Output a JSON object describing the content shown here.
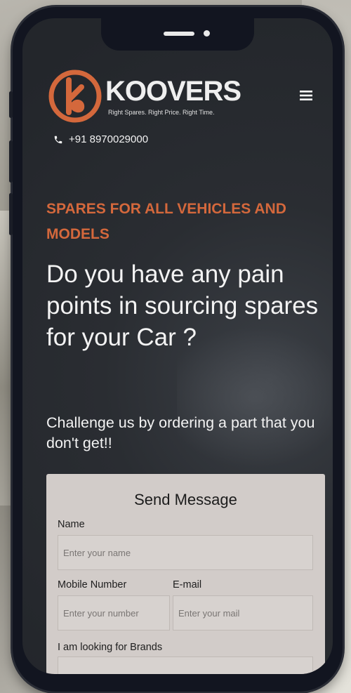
{
  "brand": {
    "name": "KOOVERS",
    "tagline": "Right Spares. Right Price. Right Time.",
    "accent_color": "#d4683c",
    "logo_icon": "koovers-logo-icon"
  },
  "header": {
    "menu_icon": "hamburger-menu-icon",
    "phone_icon": "phone-icon",
    "phone_number": "+91 8970029000"
  },
  "hero": {
    "eyebrow": "SPARES FOR ALL VEHICLES AND MODELS",
    "headline": "Do you have any pain points in sourcing spares for your Car ?",
    "subline": "Challenge us by ordering a part that you don't get!!"
  },
  "form": {
    "title": "Send Message",
    "name_label": "Name",
    "name_placeholder": "Enter your name",
    "mobile_label": "Mobile Number",
    "mobile_placeholder": "Enter your number",
    "email_label": "E-mail",
    "email_placeholder": "Enter your mail",
    "brands_label": "I am looking for Brands"
  }
}
